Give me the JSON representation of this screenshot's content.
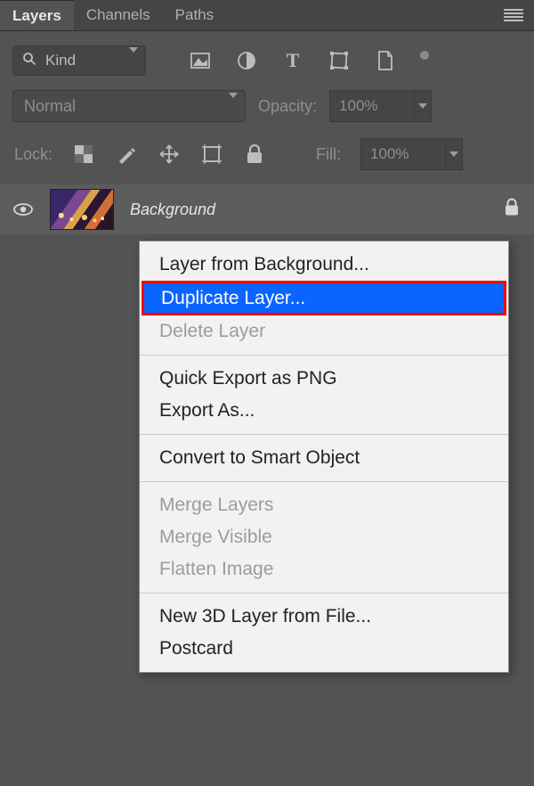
{
  "tabs": {
    "layers": "Layers",
    "channels": "Channels",
    "paths": "Paths",
    "active": 0
  },
  "kind": {
    "label": "Kind"
  },
  "blend": {
    "mode": "Normal",
    "opacity_label": "Opacity:",
    "opacity_value": "100%"
  },
  "lock": {
    "label": "Lock:",
    "fill_label": "Fill:",
    "fill_value": "100%"
  },
  "layer": {
    "name": "Background",
    "locked": true
  },
  "context_menu": {
    "sections": [
      [
        {
          "label": "Layer from Background...",
          "enabled": true
        },
        {
          "label": "Duplicate Layer...",
          "enabled": true,
          "highlight": true
        },
        {
          "label": "Delete Layer",
          "enabled": false
        }
      ],
      [
        {
          "label": "Quick Export as PNG",
          "enabled": true
        },
        {
          "label": "Export As...",
          "enabled": true
        }
      ],
      [
        {
          "label": "Convert to Smart Object",
          "enabled": true
        }
      ],
      [
        {
          "label": "Merge Layers",
          "enabled": false
        },
        {
          "label": "Merge Visible",
          "enabled": false
        },
        {
          "label": "Flatten Image",
          "enabled": false
        }
      ],
      [
        {
          "label": "New 3D Layer from File...",
          "enabled": true
        },
        {
          "label": "Postcard",
          "enabled": true
        }
      ]
    ]
  }
}
